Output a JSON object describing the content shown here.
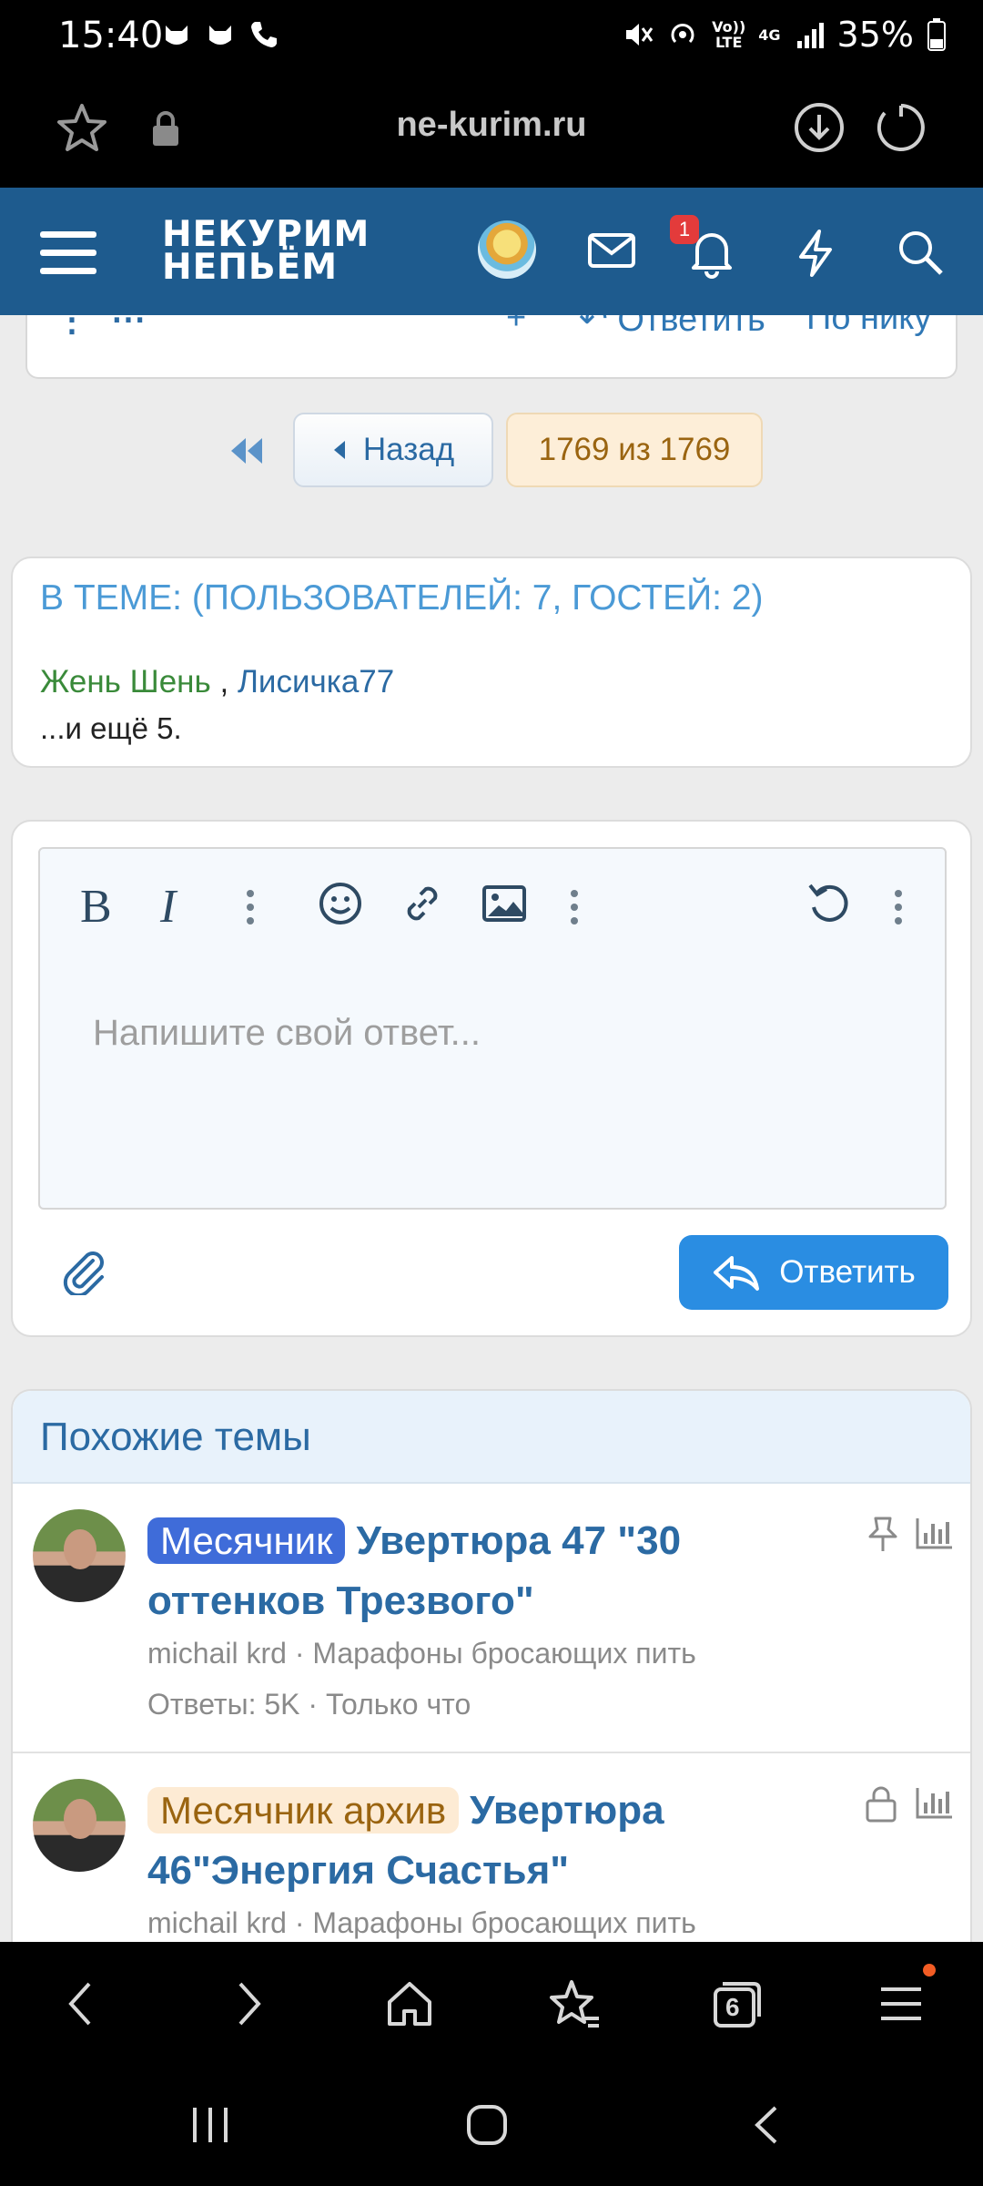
{
  "status": {
    "time": "15:40",
    "battery": "35%",
    "volte_top": "Vo))",
    "volte_bottom": "LTE",
    "net": "4G"
  },
  "browser": {
    "url": "ne-kurim.ru",
    "tabs_count": "6"
  },
  "site": {
    "logo_line1": "НЕКУРИМ",
    "logo_line2": "НЕПЬЁМ",
    "notif_count": "1"
  },
  "partial_post": {
    "reply": "Ответить",
    "by_nick": "По нику",
    "plus": "+"
  },
  "pager": {
    "back": "Назад",
    "count": "1769 из 1769"
  },
  "online": {
    "title": "В ТЕМЕ: (ПОЛЬЗОВАТЕЛЕЙ: 7, ГОСТЕЙ: 2)",
    "user1": "Жень Шень",
    "separator": ",",
    "user2": "Лисичка77",
    "more": "...и ещё 5."
  },
  "editor": {
    "placeholder": "Напишите свой ответ...",
    "submit": "Ответить"
  },
  "similar": {
    "title": "Похожие темы",
    "items": [
      {
        "tag": "Месячник",
        "title": "Увертюра 47 \"30 оттенков Трезвого\"",
        "author": "michail krd",
        "forum": "Марафоны бросающих пить",
        "stats": "Ответы: 5K · Только что"
      },
      {
        "tag": "Месячник архив",
        "title": "Увертюра 46\"Энергия Счастья\"",
        "author": "michail krd",
        "forum": "Марафоны бросающих пить"
      }
    ]
  },
  "colors": {
    "header": "#1e5b8e",
    "accent": "#2a8de2",
    "link": "#2b6aa3",
    "online_title": "#4b9ad6",
    "tag_blue": "#3f6cd9",
    "tag_orange_bg": "#fdebd4"
  }
}
